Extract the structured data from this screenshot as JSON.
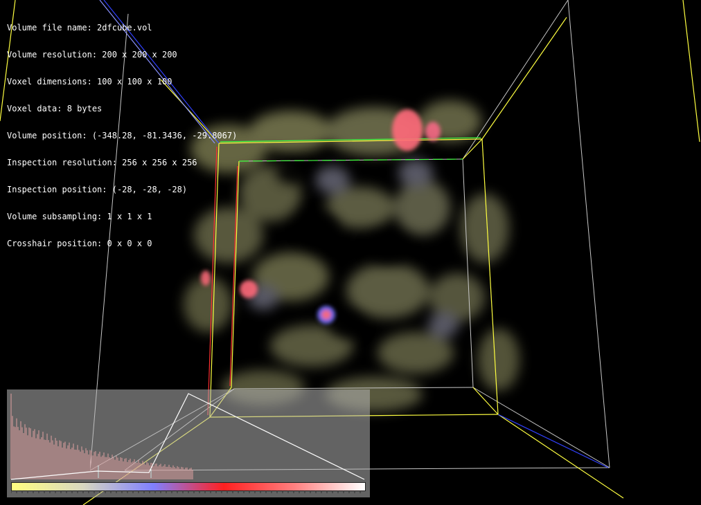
{
  "info_lines": [
    "Volume file name: 2dfcube.vol",
    "Volume resolution: 200 x 200 x 200",
    "Voxel dimensions: 100 x 100 x 100",
    "Voxel data: 8 bytes",
    "Volume position: (-348.28, -81.3436, -29.8067)",
    "Inspection resolution: 256 x 256 x 256",
    "Inspection position: (-28, -28, -28)",
    "Volume subsampling: 1 x 1 x 1",
    "Crosshair position: 0 x 0 x 0"
  ],
  "colors": {
    "background": "#000000",
    "box_outer": "#c8c8c8",
    "box_yellow": "#ffff40",
    "box_green": "#40ff40",
    "box_red": "#ff3030",
    "box_blue": "#3040ff",
    "cloud": "#d8d890",
    "blob": "#ff6a7a",
    "blob_blue": "#7070ff"
  },
  "transfer_function": {
    "colormap_stops": [
      "#ffff80",
      "#d8d8c0",
      "#8080ff",
      "#ff2020",
      "#ff8080",
      "#ffffff"
    ],
    "histogram_peak": 0.75,
    "histogram_decay": 0.0065
  }
}
